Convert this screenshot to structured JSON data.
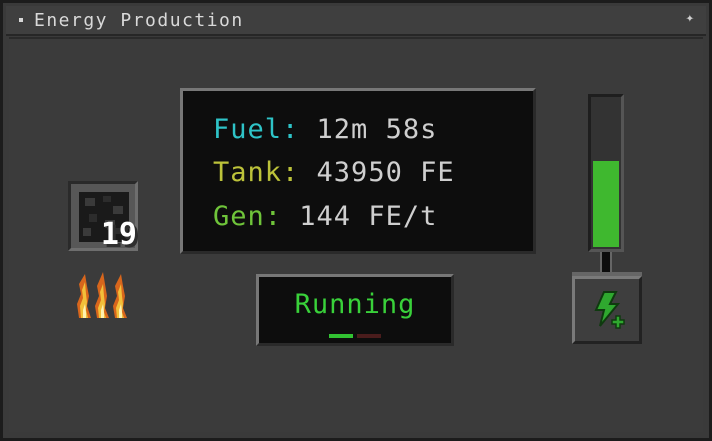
{
  "window": {
    "title": "Energy Production"
  },
  "fuel_slot": {
    "item": "coal",
    "count": "19"
  },
  "info": {
    "fuel_label": "Fuel:",
    "fuel_value": "12m 58s",
    "tank_label": "Tank:",
    "tank_value": "43950 FE",
    "gen_label": "Gen:",
    "gen_value": "144 FE/t"
  },
  "status": {
    "text": "Running"
  },
  "energy_bar": {
    "fill_fraction": 0.58
  },
  "colors": {
    "fuel_label": "#2ec3c7",
    "tank_label": "#bcc23a",
    "gen_label": "#6fc43a",
    "running": "#39d13a",
    "energy": "#3fb82f"
  },
  "icons": [
    "coal-item-icon",
    "flame-icon",
    "lightning-plus-icon"
  ]
}
